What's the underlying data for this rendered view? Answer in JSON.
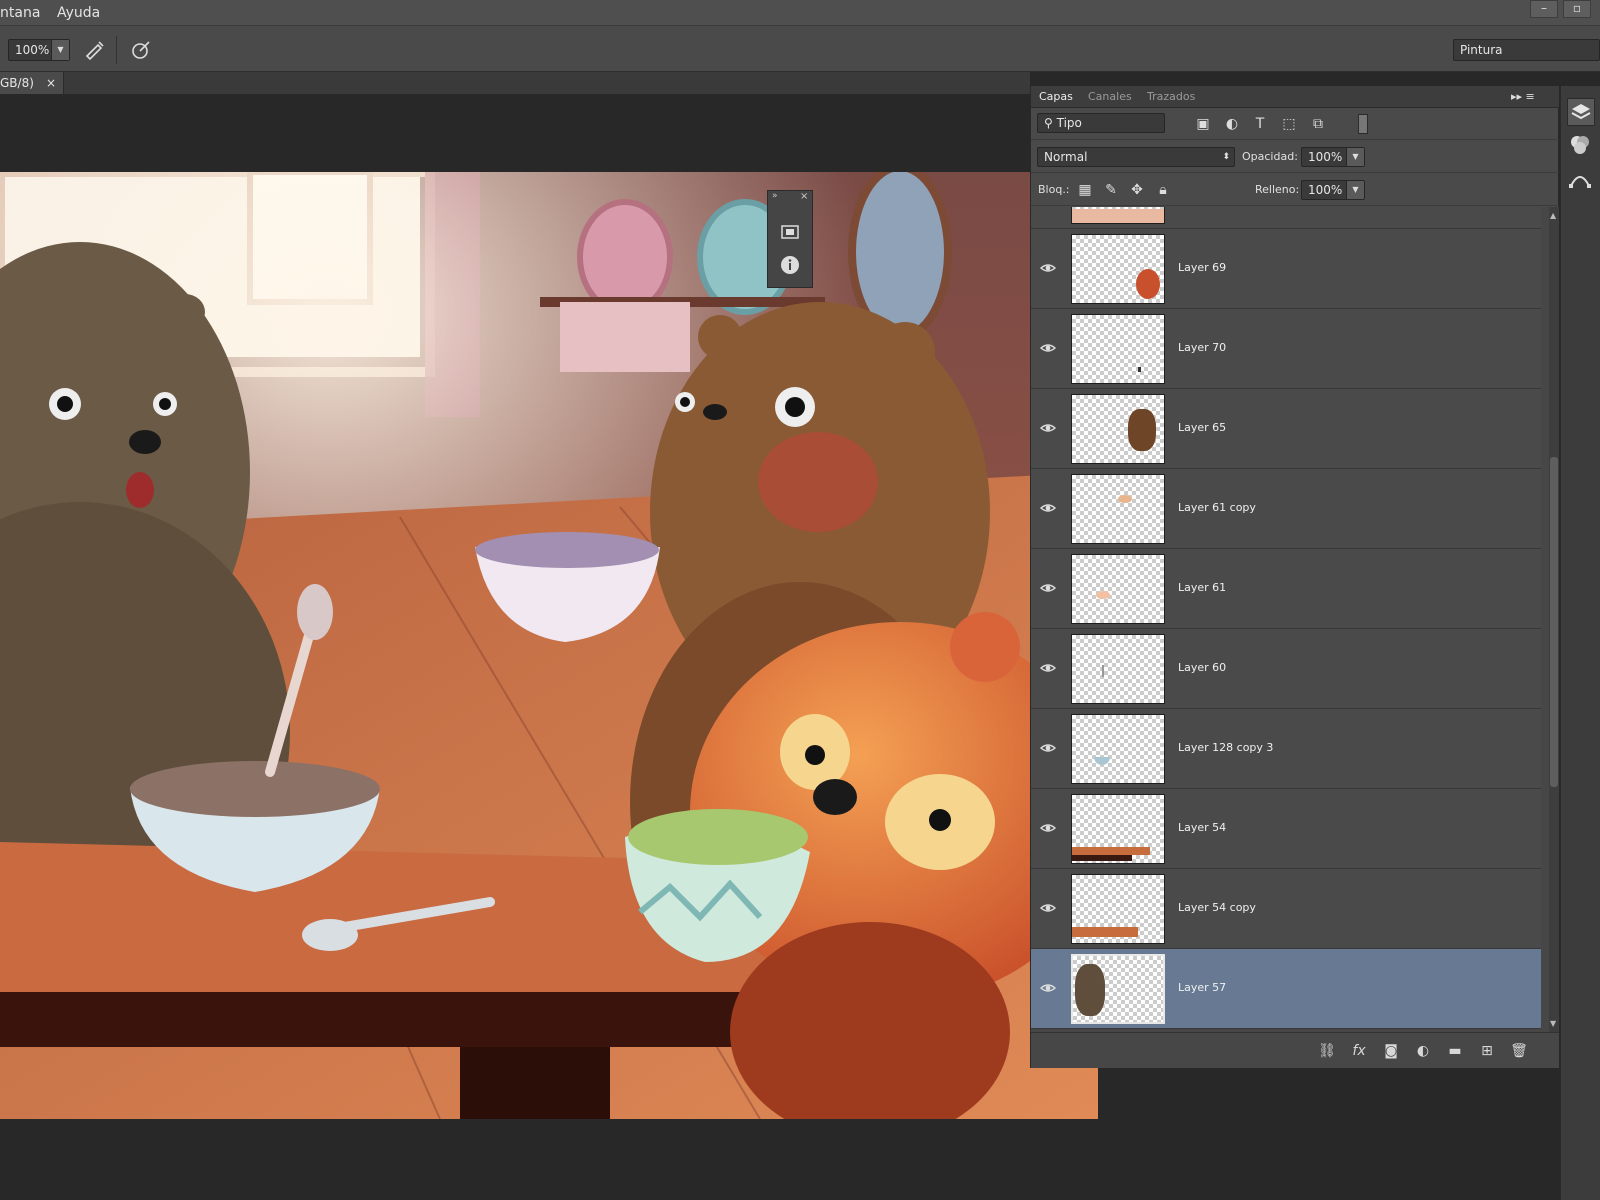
{
  "menu": {
    "items": [
      "ntana",
      "Ayuda"
    ]
  },
  "options_bar": {
    "zoom_value": "100%",
    "workspace_label": "Pintura"
  },
  "document": {
    "tab_label": "GB/8)",
    "close_glyph": "×"
  },
  "layers_panel": {
    "tabs": [
      "Capas",
      "Canales",
      "Trazados"
    ],
    "filter_label": "Tipo",
    "blend_mode": "Normal",
    "opacity_label": "Opacidad:",
    "opacity_value": "100%",
    "lock_label": "Bloq.:",
    "fill_label": "Relleno:",
    "fill_value": "100%",
    "layers": [
      {
        "name": "Layer 69",
        "visible": true,
        "selected": false
      },
      {
        "name": "Layer 70",
        "visible": true,
        "selected": false
      },
      {
        "name": "Layer 65",
        "visible": true,
        "selected": false
      },
      {
        "name": "Layer 61 copy",
        "visible": true,
        "selected": false
      },
      {
        "name": "Layer 61",
        "visible": true,
        "selected": false
      },
      {
        "name": "Layer 60",
        "visible": true,
        "selected": false
      },
      {
        "name": "Layer 128 copy 3",
        "visible": true,
        "selected": false
      },
      {
        "name": "Layer 54",
        "visible": true,
        "selected": false
      },
      {
        "name": "Layer 54 copy",
        "visible": true,
        "selected": false
      },
      {
        "name": "Layer 57",
        "visible": true,
        "selected": true
      }
    ]
  },
  "colors": {
    "selected_layer": "#687a93",
    "panel_bg": "#4a4a4a"
  }
}
